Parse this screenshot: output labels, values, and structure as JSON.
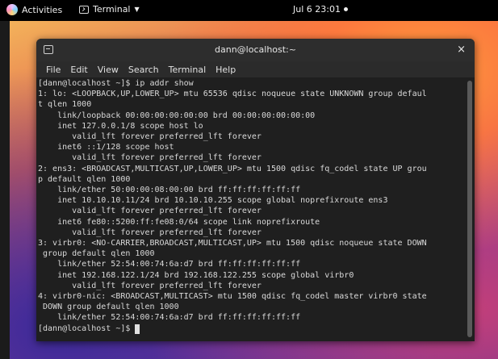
{
  "topbar": {
    "activities_label": "Activities",
    "app_label": "Terminal",
    "clock": "Jul 6  23:01"
  },
  "window": {
    "title": "dann@localhost:~",
    "close_glyph": "×",
    "menu": [
      "File",
      "Edit",
      "View",
      "Search",
      "Terminal",
      "Help"
    ]
  },
  "terminal": {
    "lines": [
      "[dann@localhost ~]$ ip addr show",
      "1: lo: <LOOPBACK,UP,LOWER_UP> mtu 65536 qdisc noqueue state UNKNOWN group defaul",
      "t qlen 1000",
      "    link/loopback 00:00:00:00:00:00 brd 00:00:00:00:00:00",
      "    inet 127.0.0.1/8 scope host lo",
      "       valid_lft forever preferred_lft forever",
      "    inet6 ::1/128 scope host",
      "       valid_lft forever preferred_lft forever",
      "2: ens3: <BROADCAST,MULTICAST,UP,LOWER_UP> mtu 1500 qdisc fq_codel state UP grou",
      "p default qlen 1000",
      "    link/ether 50:00:00:08:00:00 brd ff:ff:ff:ff:ff:ff",
      "    inet 10.10.10.11/24 brd 10.10.10.255 scope global noprefixroute ens3",
      "       valid_lft forever preferred_lft forever",
      "    inet6 fe80::5200:ff:fe08:0/64 scope link noprefixroute",
      "       valid_lft forever preferred_lft forever",
      "3: virbr0: <NO-CARRIER,BROADCAST,MULTICAST,UP> mtu 1500 qdisc noqueue state DOWN",
      " group default qlen 1000",
      "    link/ether 52:54:00:74:6a:d7 brd ff:ff:ff:ff:ff:ff",
      "    inet 192.168.122.1/24 brd 192.168.122.255 scope global virbr0",
      "       valid_lft forever preferred_lft forever",
      "4: virbr0-nic: <BROADCAST,MULTICAST> mtu 1500 qdisc fq_codel master virbr0 state",
      " DOWN group default qlen 1000",
      "    link/ether 52:54:00:74:6a:d7 brd ff:ff:ff:ff:ff:ff"
    ],
    "prompt": "[dann@localhost ~]$ "
  }
}
